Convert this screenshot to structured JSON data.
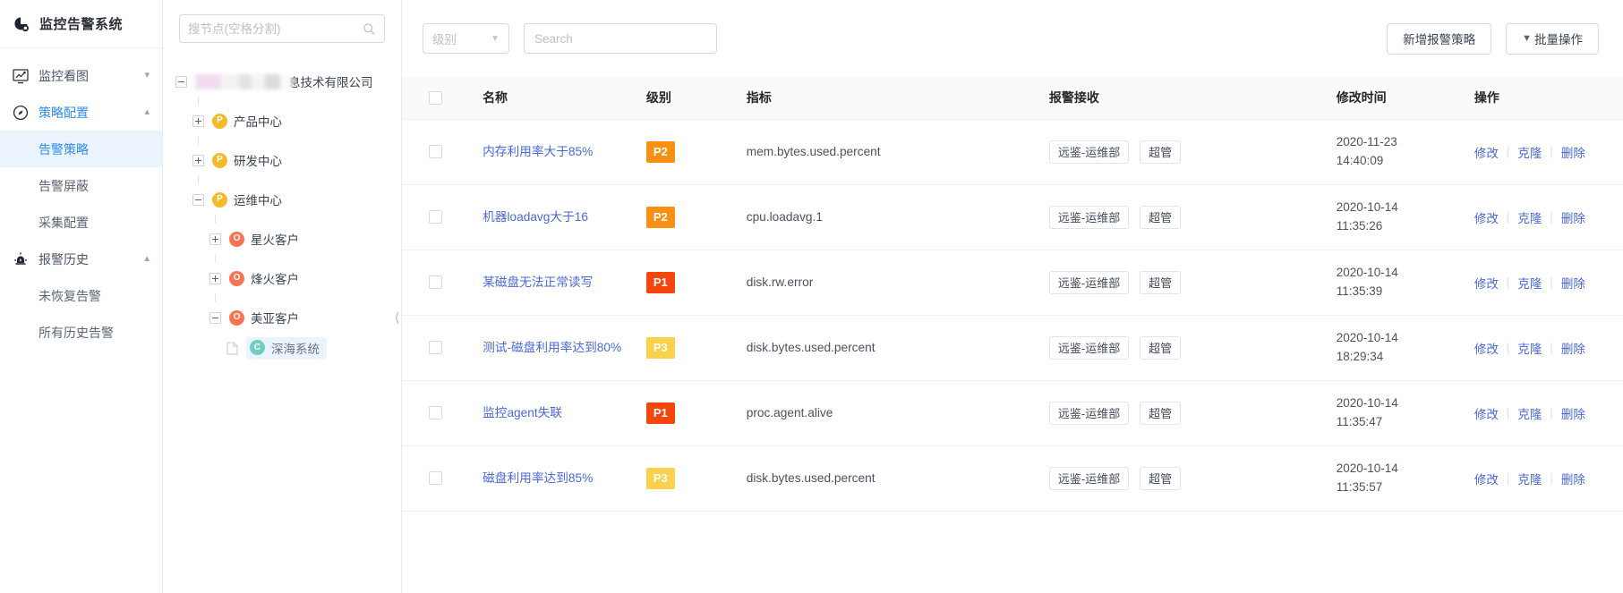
{
  "app": {
    "title": "监控告警系统",
    "logo_icon": "pie-bell-icon"
  },
  "sidebar": {
    "groups": [
      {
        "icon": "monitor-chart-icon",
        "label": "监控看图",
        "chevron": "chevron-down-icon",
        "expanded": false,
        "children": []
      },
      {
        "icon": "compass-icon",
        "label": "策略配置",
        "chevron": "chevron-up-icon",
        "expanded": true,
        "children": [
          {
            "label": "告警策略",
            "active": true
          },
          {
            "label": "告警屏蔽",
            "active": false
          },
          {
            "label": "采集配置",
            "active": false
          }
        ]
      },
      {
        "icon": "alarm-light-icon",
        "label": "报警历史",
        "chevron": "chevron-up-icon",
        "expanded": true,
        "children": [
          {
            "label": "未恢复告警",
            "active": false
          },
          {
            "label": "所有历史告警",
            "active": false
          }
        ]
      }
    ]
  },
  "tree": {
    "search_placeholder": "搜节点(空格分割)",
    "search_value": "",
    "search_icon": "search-icon",
    "nodes": [
      {
        "indent": 0,
        "switcher": "minus",
        "badge": null,
        "blurred": true,
        "label": "息技术有限公司",
        "selected": false
      },
      {
        "indent": 1,
        "switcher": "plus",
        "badge": "P",
        "badge_color": "#f5ba2a",
        "label": "产品中心",
        "selected": false
      },
      {
        "indent": 1,
        "switcher": "plus",
        "badge": "P",
        "badge_color": "#f5ba2a",
        "label": "研发中心",
        "selected": false
      },
      {
        "indent": 1,
        "switcher": "minus",
        "badge": "P",
        "badge_color": "#f5ba2a",
        "label": "运维中心",
        "selected": false
      },
      {
        "indent": 2,
        "switcher": "plus",
        "badge": "O",
        "badge_color": "#fa7352",
        "label": "星火客户",
        "selected": false
      },
      {
        "indent": 2,
        "switcher": "plus",
        "badge": "O",
        "badge_color": "#fa7352",
        "label": "烽火客户",
        "selected": false
      },
      {
        "indent": 2,
        "switcher": "minus",
        "badge": "O",
        "badge_color": "#fa7352",
        "label": "美亚客户",
        "selected": false
      },
      {
        "indent": 3,
        "switcher": "file",
        "badge": "C",
        "badge_color": "#6ecec2",
        "label": "深海系统",
        "selected": true
      }
    ],
    "collapse_handle_icon": "chevron-left-icon"
  },
  "toolbar": {
    "level_filter": {
      "placeholder": "级别",
      "value": "",
      "chevron": "chevron-down-icon"
    },
    "search": {
      "placeholder": "Search",
      "value": ""
    },
    "add_button": "新增报警策略",
    "batch_button": "批量操作",
    "batch_chevron": "chevron-down-icon"
  },
  "table": {
    "columns": [
      "",
      "名称",
      "级别",
      "指标",
      "报警接收",
      "修改时间",
      "操作"
    ],
    "select_all_checked": false,
    "ops": {
      "edit": "修改",
      "clone": "克隆",
      "delete": "删除"
    },
    "level_colors": {
      "P1": "#f5460c",
      "P2": "#f99014",
      "P3": "#fad14b"
    },
    "rows": [
      {
        "checked": false,
        "name": "内存利用率大于85%",
        "level": "P2",
        "metric": "mem.bytes.used.percent",
        "receivers": [
          "远鉴-运维部",
          "超管"
        ],
        "time_date": "2020-11-23",
        "time_clock": "14:40:09"
      },
      {
        "checked": false,
        "name": "机器loadavg大于16",
        "level": "P2",
        "metric": "cpu.loadavg.1",
        "receivers": [
          "远鉴-运维部",
          "超管"
        ],
        "time_date": "2020-10-14",
        "time_clock": "11:35:26"
      },
      {
        "checked": false,
        "name": "某磁盘无法正常读写",
        "level": "P1",
        "metric": "disk.rw.error",
        "receivers": [
          "远鉴-运维部",
          "超管"
        ],
        "time_date": "2020-10-14",
        "time_clock": "11:35:39"
      },
      {
        "checked": false,
        "name": "测试-磁盘利用率达到80%",
        "level": "P3",
        "metric": "disk.bytes.used.percent",
        "receivers": [
          "远鉴-运维部",
          "超管"
        ],
        "time_date": "2020-10-14",
        "time_clock": "18:29:34"
      },
      {
        "checked": false,
        "name": "监控agent失联",
        "level": "P1",
        "metric": "proc.agent.alive",
        "receivers": [
          "远鉴-运维部",
          "超管"
        ],
        "time_date": "2020-10-14",
        "time_clock": "11:35:47"
      },
      {
        "checked": false,
        "name": "磁盘利用率达到85%",
        "level": "P3",
        "metric": "disk.bytes.used.percent",
        "receivers": [
          "远鉴-运维部",
          "超管"
        ],
        "time_date": "2020-10-14",
        "time_clock": "11:35:57"
      }
    ]
  }
}
